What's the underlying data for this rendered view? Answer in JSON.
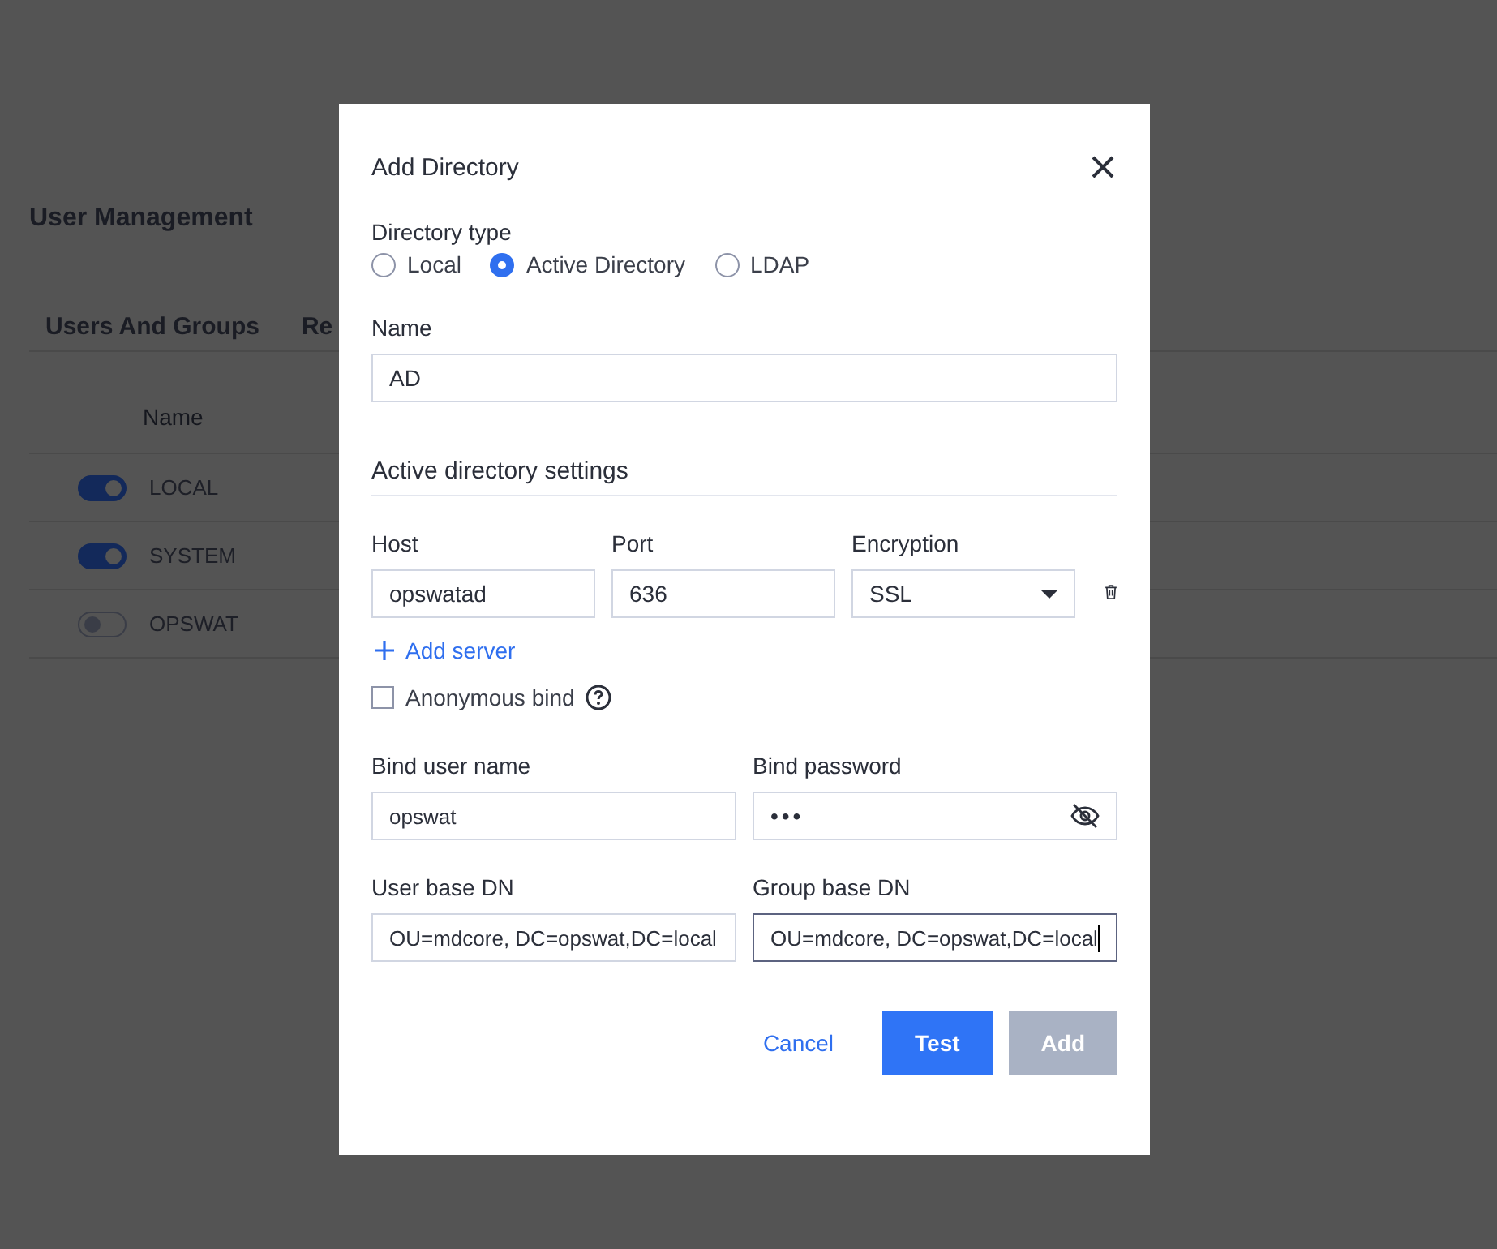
{
  "page": {
    "title": "User Management",
    "tabs": [
      "Users And Groups",
      "Re"
    ],
    "table": {
      "columns": [
        "Name"
      ],
      "rows": [
        {
          "name": "LOCAL",
          "enabled": true
        },
        {
          "name": "SYSTEM",
          "enabled": true
        },
        {
          "name": "OPSWAT",
          "enabled": false
        }
      ]
    }
  },
  "dialog": {
    "title": "Add Directory",
    "directory_type": {
      "label": "Directory type",
      "options": [
        {
          "label": "Local",
          "selected": false
        },
        {
          "label": "Active Directory",
          "selected": true
        },
        {
          "label": "LDAP",
          "selected": false
        }
      ]
    },
    "name": {
      "label": "Name",
      "value": "AD"
    },
    "section_title": "Active directory settings",
    "host": {
      "label": "Host",
      "value": "opswatad"
    },
    "port": {
      "label": "Port",
      "value": "636"
    },
    "encryption": {
      "label": "Encryption",
      "value": "SSL"
    },
    "add_server": "Add server",
    "anonymous_bind": {
      "label": "Anonymous bind",
      "checked": false
    },
    "bind_user": {
      "label": "Bind user name",
      "value": "opswat"
    },
    "bind_password": {
      "label": "Bind password",
      "value": "•••"
    },
    "user_base_dn": {
      "label": "User base DN",
      "value": "OU=mdcore, DC=opswat,DC=local",
      "focused": false
    },
    "group_base_dn": {
      "label": "Group base DN",
      "value": "OU=mdcore, DC=opswat,DC=local",
      "focused": true
    },
    "buttons": [
      {
        "label": "Cancel",
        "kind": "link"
      },
      {
        "label": "Test",
        "kind": "primary"
      },
      {
        "label": "Add",
        "kind": "disabled"
      }
    ]
  }
}
